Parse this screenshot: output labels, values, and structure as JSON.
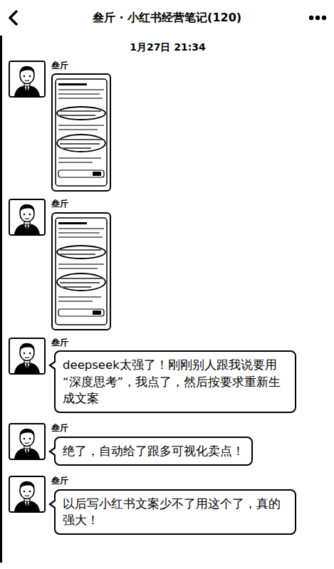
{
  "header": {
    "title": "叁斤 · 小红书经营笔记(120)"
  },
  "timestamp": "1月27日 21:34",
  "messages": [
    {
      "sender": "叁斤",
      "kind": "image"
    },
    {
      "sender": "叁斤",
      "kind": "image"
    },
    {
      "sender": "叁斤",
      "kind": "text",
      "text": "deepseek太强了！刚刚别人跟我说要用“深度思考”，我点了，然后按要求重新生成文案"
    },
    {
      "sender": "叁斤",
      "kind": "text",
      "text": "绝了，自动给了跟多可视化卖点！"
    },
    {
      "sender": "叁斤",
      "kind": "text",
      "text": "以后写小红书文案少不了用这个了，真的强大！"
    }
  ]
}
